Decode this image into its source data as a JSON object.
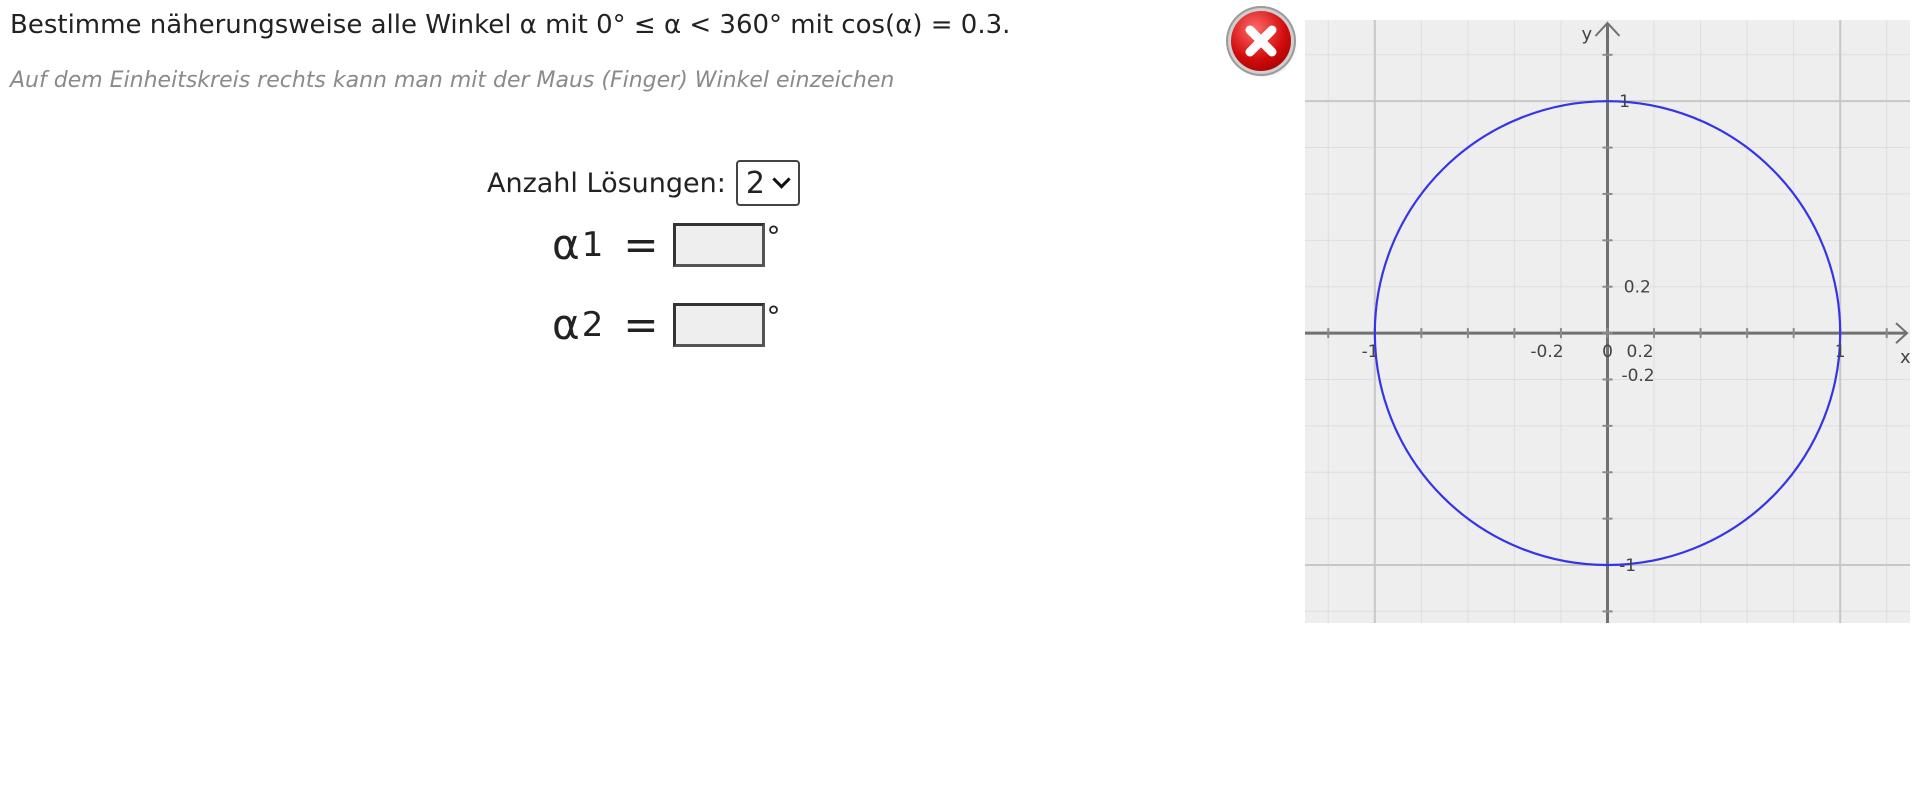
{
  "task": {
    "title": "Bestimme näherungsweise alle Winkel α mit 0° ≤ α < 360° mit cos(α) = 0.3.",
    "hint": "Auf dem Einheitskreis rechts kann man mit der Maus (Finger) Winkel einzeichen"
  },
  "form": {
    "count_label": "Anzahl Lösungen:",
    "count_value": "2",
    "answers": [
      {
        "symbol": "α",
        "index": "1",
        "equals": "=",
        "value": "",
        "unit": "°"
      },
      {
        "symbol": "α",
        "index": "2",
        "equals": "=",
        "value": "",
        "unit": "°"
      }
    ]
  },
  "close_button": {
    "icon": "close-x-icon",
    "color": "#d10b0b"
  },
  "chart_data": {
    "type": "line",
    "series": [
      {
        "function": "x² + y² = 1",
        "color": "#3535e8"
      }
    ],
    "xlabel": "x",
    "ylabel": "y",
    "xlim": [
      -1.3,
      1.3
    ],
    "ylim": [
      -1.25,
      1.35
    ],
    "grid": true,
    "x_tick_labels": [
      "-1",
      "-0.2",
      "0",
      "0.2",
      "1"
    ],
    "y_tick_labels": [
      "1",
      "0.2",
      "-0.2",
      "-1"
    ]
  }
}
